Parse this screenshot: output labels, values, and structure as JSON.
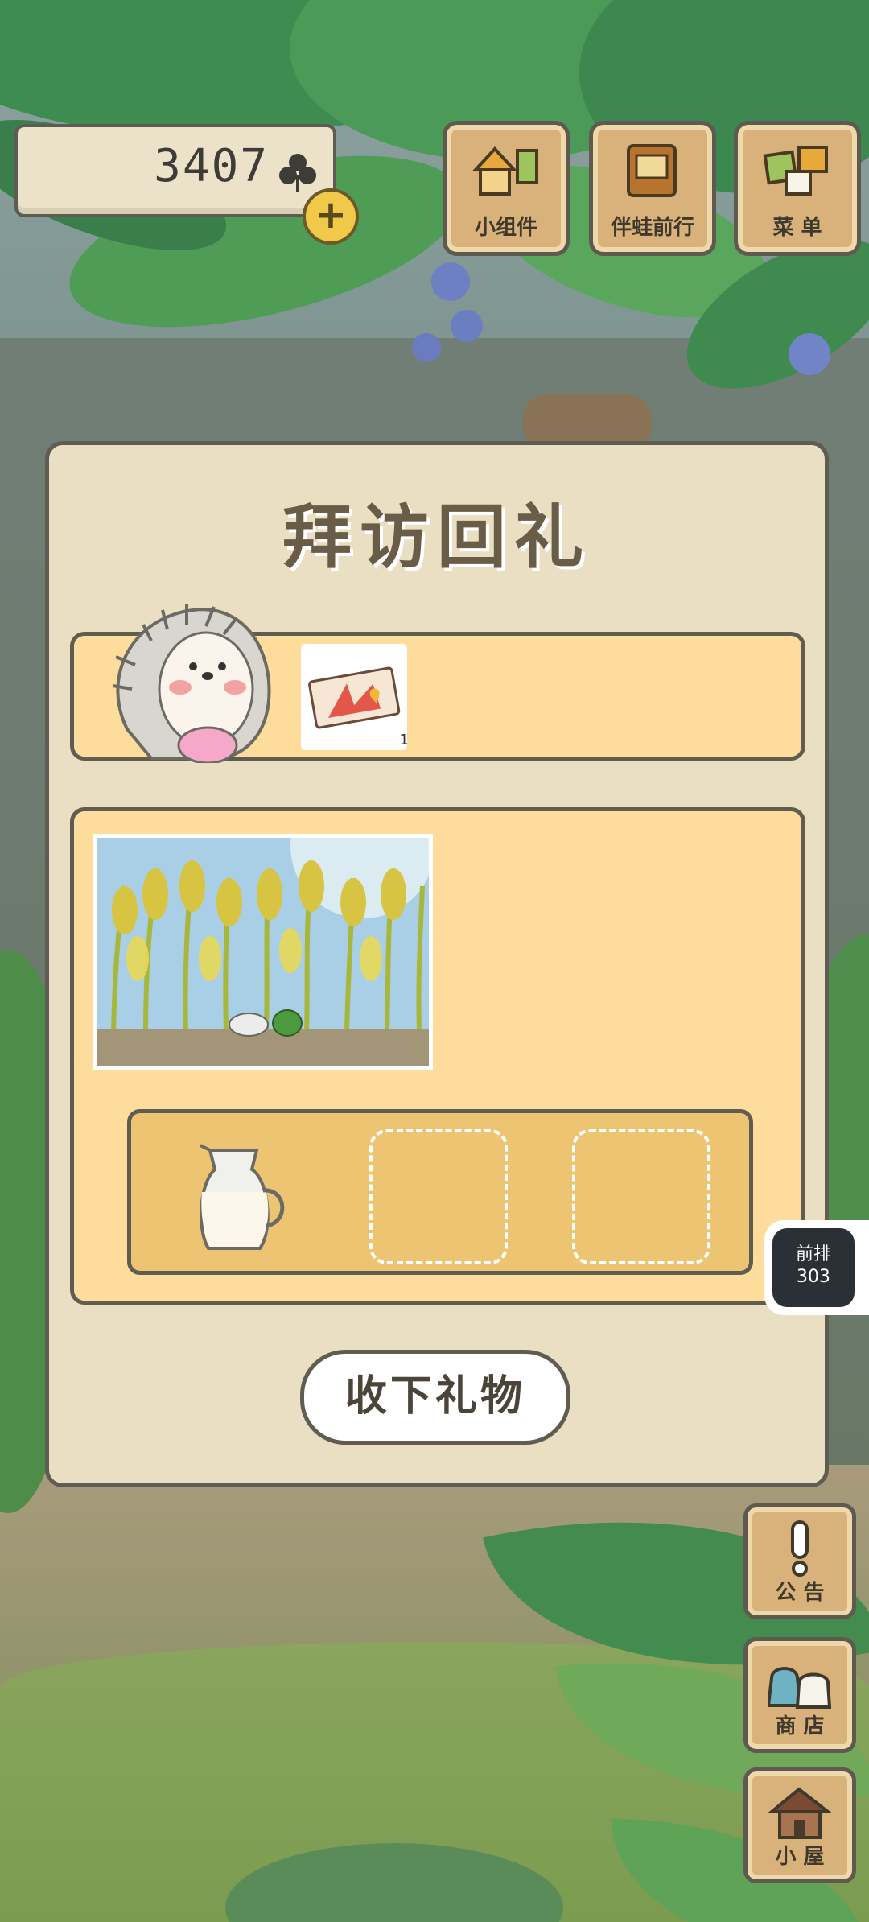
{
  "hud": {
    "clover_count": "3407",
    "plus_label": "+",
    "top_buttons": [
      {
        "label": "小组件",
        "icon": "widget-icon"
      },
      {
        "label": "伴蛙前行",
        "icon": "book-icon"
      },
      {
        "label": "菜 单",
        "icon": "menu-icon"
      }
    ]
  },
  "dialog": {
    "title": "拜访回礼",
    "ticket_count": "1",
    "accept_label": "收下礼物"
  },
  "side_badge": {
    "line1": "前排",
    "line2": "303"
  },
  "right_buttons": [
    {
      "label": "公 告",
      "icon": "exclamation-icon"
    },
    {
      "label": "商 店",
      "icon": "shop-bags-icon"
    },
    {
      "label": "小 屋",
      "icon": "house-icon"
    }
  ],
  "colors": {
    "panel": "#fedd9c",
    "dialog_bg": "#eadfc2",
    "border": "#5f5c52",
    "tray": "#edc572"
  }
}
